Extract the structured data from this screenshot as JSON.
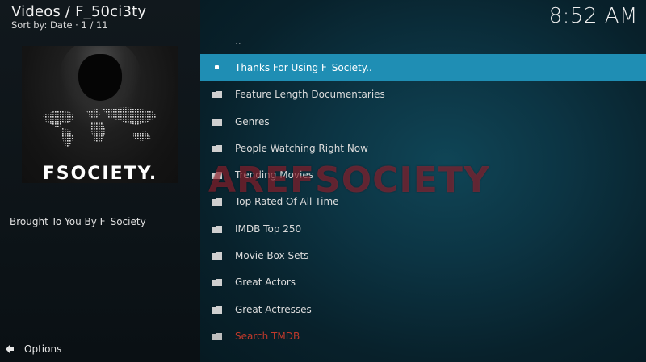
{
  "header": {
    "title": "Videos / F_50ci3ty",
    "sort_info": "Sort by: Date  ·  1 / 11",
    "clock": "8:52 AM"
  },
  "poster": {
    "name": "FSOCIETY.",
    "plot": "Brought To You By F_Society"
  },
  "footer": {
    "options_label": "Options"
  },
  "list": {
    "items": [
      {
        "label": "..",
        "icon": "none"
      },
      {
        "label": "Thanks For Using F_Society..",
        "icon": "selected-dot-icon"
      },
      {
        "label": "Feature Length Documentaries",
        "icon": "folder-icon"
      },
      {
        "label": "Genres",
        "icon": "folder-icon"
      },
      {
        "label": "People Watching Right Now",
        "icon": "folder-icon"
      },
      {
        "label": "Trending Movies",
        "icon": "folder-icon"
      },
      {
        "label": "Top Rated Of All Time",
        "icon": "folder-icon"
      },
      {
        "label": "IMDB Top 250",
        "icon": "folder-icon"
      },
      {
        "label": "Movie Box Sets",
        "icon": "folder-icon"
      },
      {
        "label": "Great Actors",
        "icon": "folder-icon"
      },
      {
        "label": "Great Actresses",
        "icon": "folder-icon"
      },
      {
        "label": "Search TMDB",
        "icon": "folder-icon"
      }
    ]
  },
  "watermark": "AREFSOCIETY",
  "colors": {
    "selection": "#1f8eb4",
    "search_text": "#c0392b",
    "watermark": "#aa2332"
  }
}
